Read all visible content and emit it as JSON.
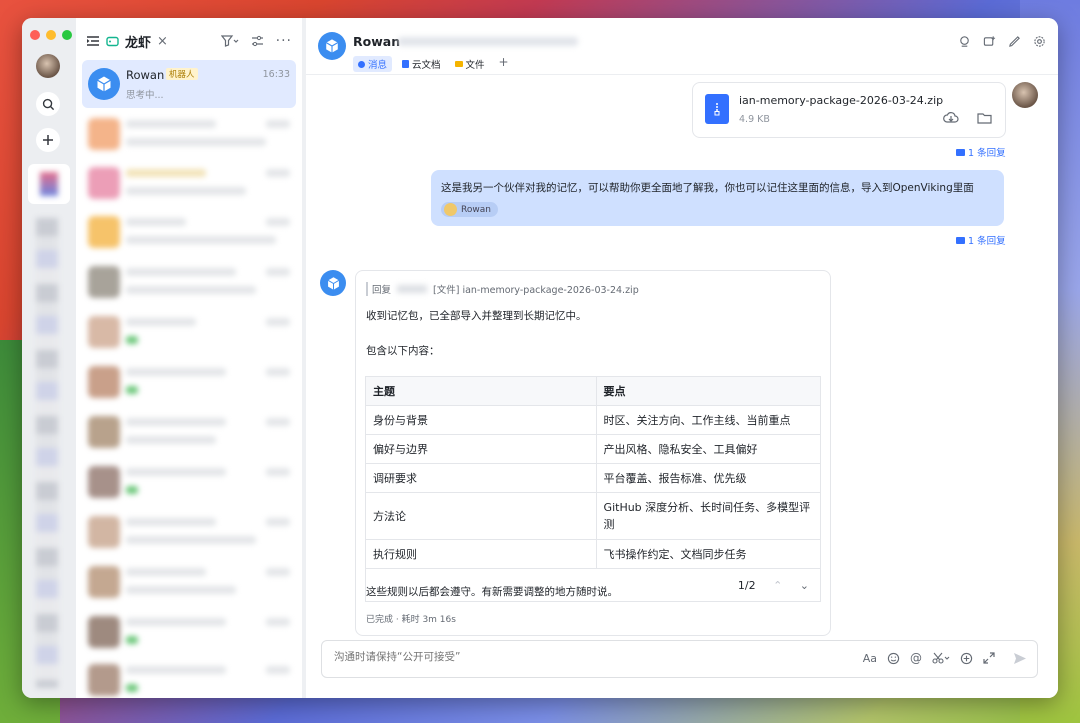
{
  "window": {
    "accent": "#3370ff"
  },
  "list_header": {
    "title": "龙虾",
    "close": "×"
  },
  "active_chat": {
    "name": "Rowan",
    "badge": "机器人",
    "time": "16:33",
    "preview": "思考中..."
  },
  "chat_header": {
    "name": "Rowan",
    "tabs": [
      {
        "label": "消息",
        "icon": "message-icon"
      },
      {
        "label": "云文档",
        "icon": "doc-icon"
      },
      {
        "label": "文件",
        "icon": "folder-icon"
      }
    ],
    "add": "+"
  },
  "file_card": {
    "name": "ian-memory-package-2026-03-24.zip",
    "size": "4.9 KB"
  },
  "replies1": "1 条回复",
  "user_msg": {
    "text": "这是我另一个伙伴对我的记忆，可以帮助你更全面地了解我，你也可以记住这里面的信息，导入到OpenViking里面",
    "mention": "Rowan"
  },
  "replies2": "1 条回复",
  "bot_msg": {
    "quote_prefix": "回复",
    "quote_file": "[文件] ian-memory-package-2026-03-24.zip",
    "line1": "收到记忆包，已全部导入并整理到长期记忆中。",
    "line2": "包含以下内容：",
    "table": {
      "headers": [
        "主题",
        "要点"
      ],
      "rows": [
        [
          "身份与背景",
          "时区、关注方向、工作主线、当前重点"
        ],
        [
          "偏好与边界",
          "产出风格、隐私安全、工具偏好"
        ],
        [
          "调研要求",
          "平台覆盖、报告标准、优先级"
        ],
        [
          "方法论",
          "GitHub 深度分析、长时间任务、多模型评测"
        ],
        [
          "执行规则",
          "飞书操作约定、文档同步任务"
        ]
      ],
      "page": "1/2"
    },
    "line3": "这些规则以后都会遵守。有新需要调整的地方随时说。",
    "footer": "已完成 · 耗时 3m 16s"
  },
  "composer": {
    "placeholder": "沟通时请保持“公开可接受”"
  }
}
